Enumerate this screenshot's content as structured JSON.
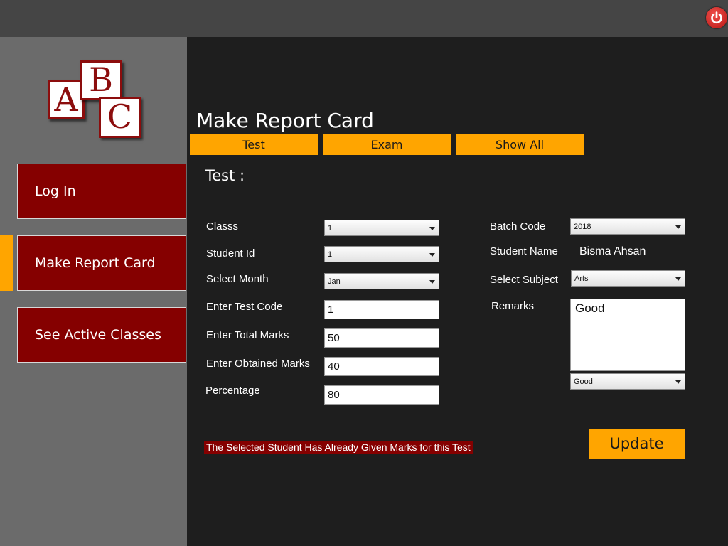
{
  "app": {
    "logo_letters": [
      "A",
      "B",
      "C"
    ]
  },
  "header": {
    "power_icon": "power-icon",
    "power_color": "#d9201c"
  },
  "sidebar": {
    "items": [
      {
        "label": "Log In"
      },
      {
        "label": "Make Report Card",
        "active": true
      },
      {
        "label": "See Active Classes"
      }
    ],
    "accent_color": "#ffa500",
    "item_color": "#850000"
  },
  "main": {
    "title": "Make Report Card",
    "tabs": [
      {
        "label": "Test"
      },
      {
        "label": "Exam"
      },
      {
        "label": "Show All"
      }
    ],
    "section_title": "Test :",
    "form": {
      "class_label": "Classs",
      "class_value": "1",
      "student_id_label": "Student Id",
      "student_id_value": "1",
      "month_label": "Select Month",
      "month_value": "Jan",
      "test_code_label": "Enter Test Code",
      "test_code_value": "1",
      "total_marks_label": "Enter Total Marks",
      "total_marks_value": "50",
      "obtained_marks_label": "Enter Obtained Marks",
      "obtained_marks_value": "40",
      "percentage_label": "Percentage",
      "percentage_value": "80",
      "batch_code_label": "Batch Code",
      "batch_code_value": "2018",
      "student_name_label": "Student Name",
      "student_name_value": "Bisma Ahsan",
      "subject_label": "Select Subject",
      "subject_value": "Arts",
      "remarks_label": "Remarks",
      "remarks_text": "Good",
      "remarks_select_value": "Good"
    },
    "status_message": "The Selected Student Has Already Given Marks for this Test",
    "update_label": "Update"
  }
}
